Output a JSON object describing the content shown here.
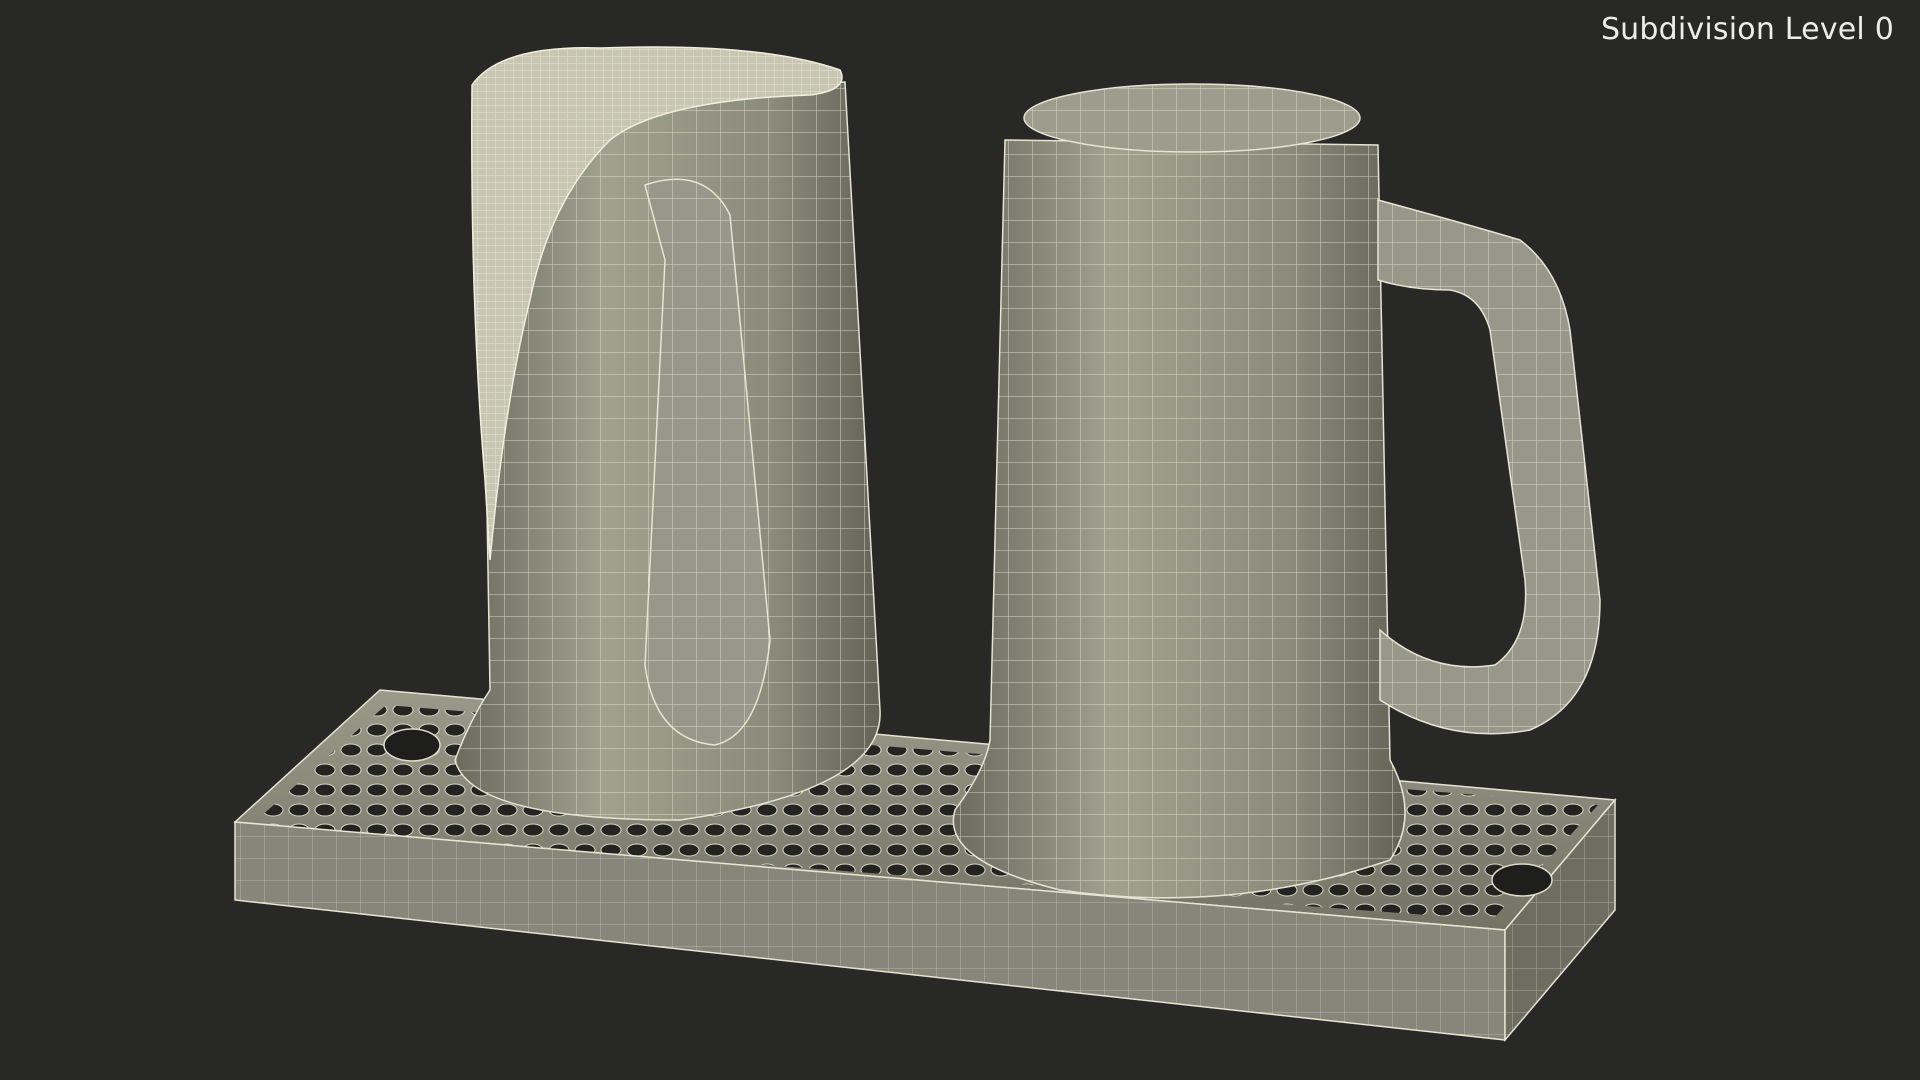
{
  "viewport": {
    "label": "Subdivision Level 0"
  },
  "colors": {
    "background": "#282827",
    "surface": "#8d8d7d",
    "wire": "#e6e4d2",
    "label": "#ececec"
  }
}
